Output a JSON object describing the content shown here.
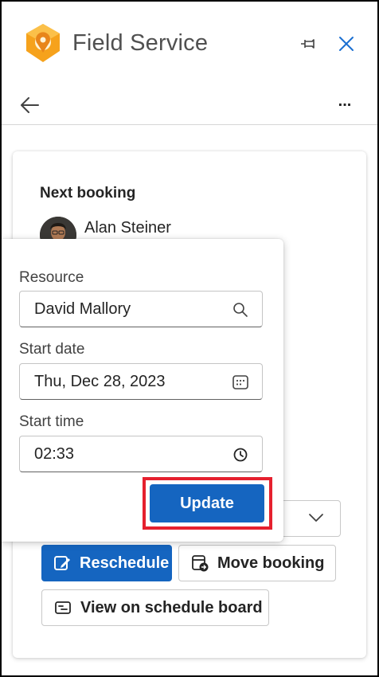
{
  "app": {
    "title": "Field Service"
  },
  "toolbar": {
    "more_label": "..."
  },
  "booking": {
    "heading": "Next booking",
    "person_name": "Alan Steiner"
  },
  "popover": {
    "resource": {
      "label": "Resource",
      "value": "David Mallory"
    },
    "start_date": {
      "label": "Start date",
      "value": "Thu, Dec 28, 2023"
    },
    "start_time": {
      "label": "Start time",
      "value": "02:33"
    },
    "update_label": "Update"
  },
  "actions": {
    "reschedule_label": "Reschedule",
    "move_booking_label": "Move booking",
    "view_board_label": "View on schedule board"
  },
  "colors": {
    "primary": "#1565c0",
    "highlight": "#e5202e",
    "logo_orange": "#f6a21c",
    "close_icon": "#1a6fd1"
  },
  "icons": [
    "field-service-logo-icon",
    "pin-icon",
    "close-icon",
    "back-arrow-icon",
    "search-icon",
    "calendar-icon",
    "clock-icon",
    "chevron-down-icon",
    "edit-icon",
    "move-icon",
    "board-icon"
  ]
}
